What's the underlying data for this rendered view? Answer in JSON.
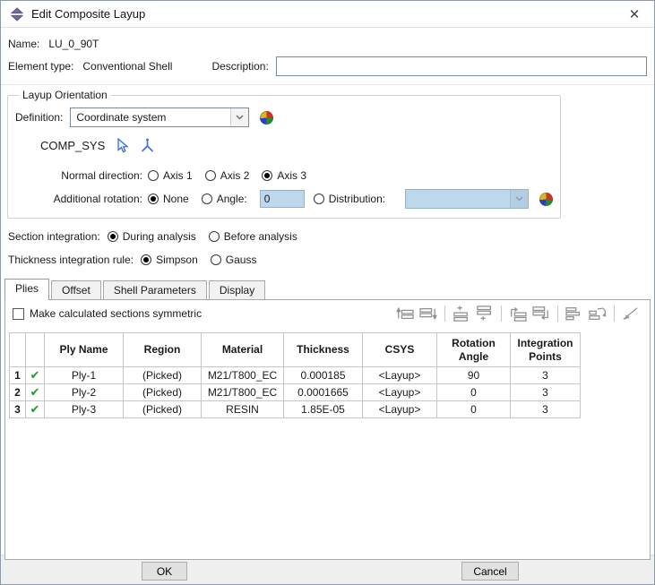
{
  "window": {
    "title": "Edit Composite Layup",
    "close_glyph": "✕"
  },
  "fields": {
    "name_label": "Name:",
    "name_value": "LU_0_90T",
    "element_type_label": "Element type:",
    "element_type_value": "Conventional Shell",
    "description_label": "Description:",
    "description_value": ""
  },
  "layup_orientation": {
    "group_title": "Layup Orientation",
    "definition_label": "Definition:",
    "definition_value": "Coordinate system",
    "csys_name": "COMP_SYS",
    "normal_direction": {
      "label": "Normal direction:",
      "options": [
        "Axis 1",
        "Axis 2",
        "Axis 3"
      ],
      "selected": "Axis 3"
    },
    "additional_rotation": {
      "label": "Additional rotation:",
      "none_label": "None",
      "angle_label": "Angle:",
      "angle_value": "0",
      "distribution_label": "Distribution:",
      "distribution_value": "",
      "selected": "None"
    }
  },
  "section_integration": {
    "label": "Section integration:",
    "options": [
      "During analysis",
      "Before analysis"
    ],
    "selected": "During analysis"
  },
  "thickness_rule": {
    "label": "Thickness integration rule:",
    "options": [
      "Simpson",
      "Gauss"
    ],
    "selected": "Simpson"
  },
  "tabs": [
    {
      "label": "Plies",
      "active": true
    },
    {
      "label": "Offset",
      "active": false
    },
    {
      "label": "Shell Parameters",
      "active": false
    },
    {
      "label": "Display",
      "active": false
    }
  ],
  "plies": {
    "symmetric_checkbox_label": "Make calculated sections symmetric",
    "symmetric_checked": false,
    "toolbar_icon_names": [
      "move-row-up",
      "move-row-down",
      "insert-row-before",
      "insert-row-after",
      "copy-row-before",
      "copy-row-after",
      "pattern-rows",
      "cycle-rows",
      "edit-validate"
    ],
    "table": {
      "headers": {
        "num": "",
        "ok": "",
        "name": "Ply Name",
        "region": "Region",
        "material": "Material",
        "thickness": "Thickness",
        "csys": "CSYS",
        "rotation": "Rotation Angle",
        "integration": "Integration Points"
      },
      "rows": [
        {
          "num": "1",
          "ok": "✔",
          "name": "Ply-1",
          "region": "(Picked)",
          "material": "M21/T800_EC",
          "thickness": "0.000185",
          "csys": "<Layup>",
          "rotation": "90",
          "integration": "3"
        },
        {
          "num": "2",
          "ok": "✔",
          "name": "Ply-2",
          "region": "(Picked)",
          "material": "M21/T800_EC",
          "thickness": "0.0001665",
          "csys": "<Layup>",
          "rotation": "0",
          "integration": "3"
        },
        {
          "num": "3",
          "ok": "✔",
          "name": "Ply-3",
          "region": "(Picked)",
          "material": "RESIN",
          "thickness": "1.85E-05",
          "csys": "<Layup>",
          "rotation": "0",
          "integration": "3"
        }
      ]
    }
  },
  "footer": {
    "ok_label": "OK",
    "cancel_label": "Cancel"
  },
  "colors": {
    "disabled_field_bg": "#bdd7ec",
    "check_green": "#1f9b27",
    "icon_blue": "#3a6fd8",
    "title_icon_purple": "#6e6ea5",
    "footer_bg": "#f0f0f0"
  }
}
